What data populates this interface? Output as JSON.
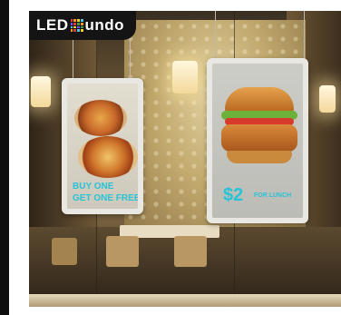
{
  "logo": {
    "text_prefix": "LED",
    "text_suffix": "undo",
    "grid_colors": [
      "#e03a3a",
      "#f29a1c",
      "#f2d21c",
      "#4fc3f7",
      "#7c4dff",
      "#e03a3a",
      "#43a047",
      "#f29a1c",
      "#4fc3f7",
      "#f2d21c",
      "#7c4dff",
      "#43a047",
      "#f29a1c",
      "#e03a3a",
      "#4fc3f7",
      "#f2d21c"
    ]
  },
  "left_display": {
    "promo_line1": "BUY ONE",
    "promo_line2": "GET ONE FREE"
  },
  "right_display": {
    "price": "$2",
    "price_note": "FOR LUNCH"
  },
  "colors": {
    "promo_text": "#27c3d6"
  }
}
